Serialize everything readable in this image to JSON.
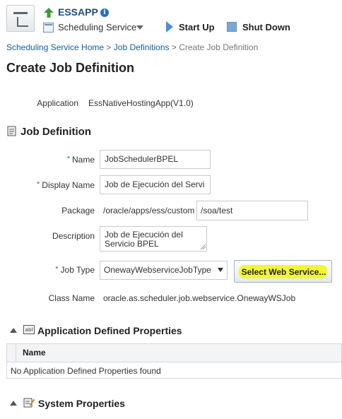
{
  "header": {
    "app_title": "ESSAPP",
    "info_icon_glyph": "i",
    "service_label": "Scheduling Service",
    "start_up_label": "Start Up",
    "shut_down_label": "Shut Down"
  },
  "breadcrumb": {
    "items": [
      "Scheduling Service Home",
      "Job Definitions"
    ],
    "separator": ">",
    "current": "Create Job Definition"
  },
  "page_title": "Create Job Definition",
  "application": {
    "label": "Application",
    "value": "EssNativeHostingApp(V1.0)"
  },
  "job_definition": {
    "section_title": "Job Definition",
    "required_mark": "*",
    "name_label": "Name",
    "name_value": "JobSchedulerBPEL",
    "display_name_label": "Display Name",
    "display_name_value": "Job de Ejecución del Servi",
    "package_label": "Package",
    "package_prefix": "/oracle/apps/ess/custom",
    "package_value": "/soa/test",
    "description_label": "Description",
    "description_line1": "Job de Ejecución del",
    "description_line2": "Servicio BPEL",
    "job_type_label": "Job Type",
    "job_type_value": "OnewayWebserviceJobType",
    "select_web_service_label": "Select Web Service...",
    "class_name_label": "Class Name",
    "class_name_value": "oracle.as.scheduler.job.webservice.OnewayWSJob"
  },
  "app_props": {
    "section_title": "Application Defined Properties",
    "column_name": "Name",
    "empty_text": "No Application Defined Properties found"
  },
  "system_props": {
    "section_title": "System Properties"
  },
  "colors": {
    "link": "#145c9e",
    "required": "#2a6ebb",
    "highlight": "#f3f733",
    "header_title": "#1f4e79",
    "up_arrow": "#3c9a3c"
  }
}
